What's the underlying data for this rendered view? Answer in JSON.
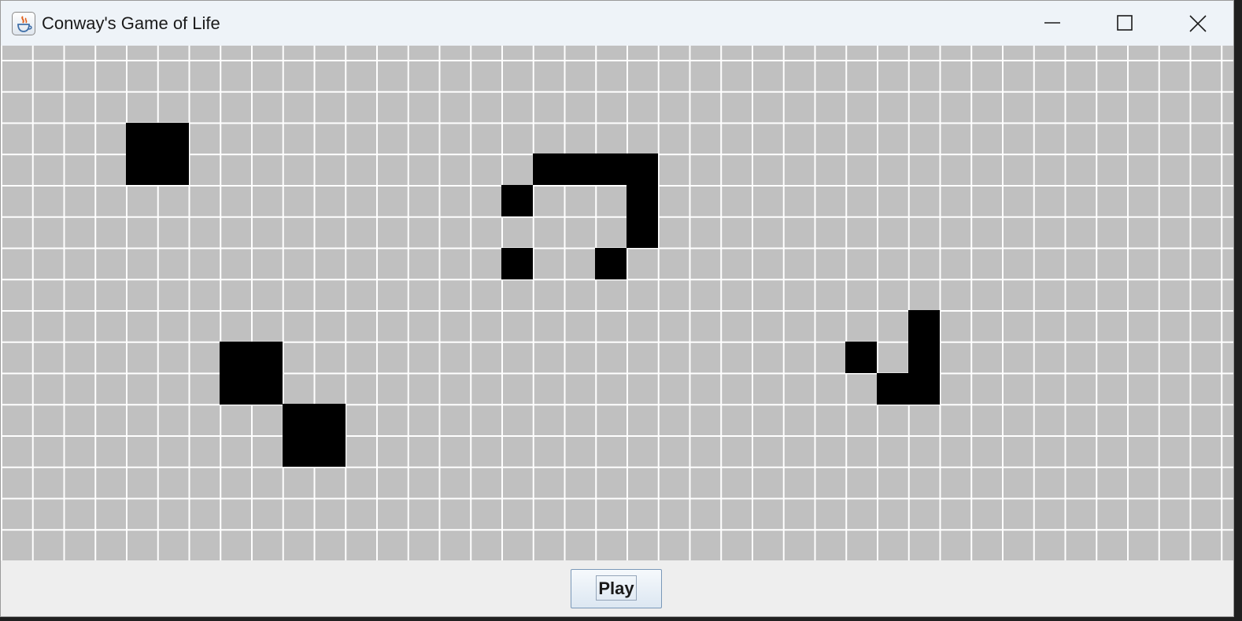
{
  "window": {
    "title": "Conway's Game of Life",
    "icon": "java-cup-icon",
    "controls": [
      "minimize-icon",
      "maximize-icon",
      "close-icon"
    ]
  },
  "board": {
    "dead_color": "#c0c0c0",
    "alive_color": "#000000",
    "grid_color": "#ffffff",
    "alive_cells": [
      [
        2,
        4
      ],
      [
        2,
        5
      ],
      [
        3,
        4
      ],
      [
        3,
        5
      ],
      [
        3,
        17
      ],
      [
        3,
        18
      ],
      [
        3,
        19
      ],
      [
        3,
        20
      ],
      [
        4,
        16
      ],
      [
        4,
        20
      ],
      [
        5,
        20
      ],
      [
        6,
        16
      ],
      [
        6,
        19
      ],
      [
        8,
        29
      ],
      [
        9,
        7
      ],
      [
        9,
        8
      ],
      [
        9,
        27
      ],
      [
        9,
        29
      ],
      [
        10,
        7
      ],
      [
        10,
        8
      ],
      [
        10,
        28
      ],
      [
        10,
        29
      ],
      [
        11,
        9
      ],
      [
        11,
        10
      ],
      [
        12,
        9
      ],
      [
        12,
        10
      ]
    ]
  },
  "controls": {
    "play_label": "Play"
  }
}
